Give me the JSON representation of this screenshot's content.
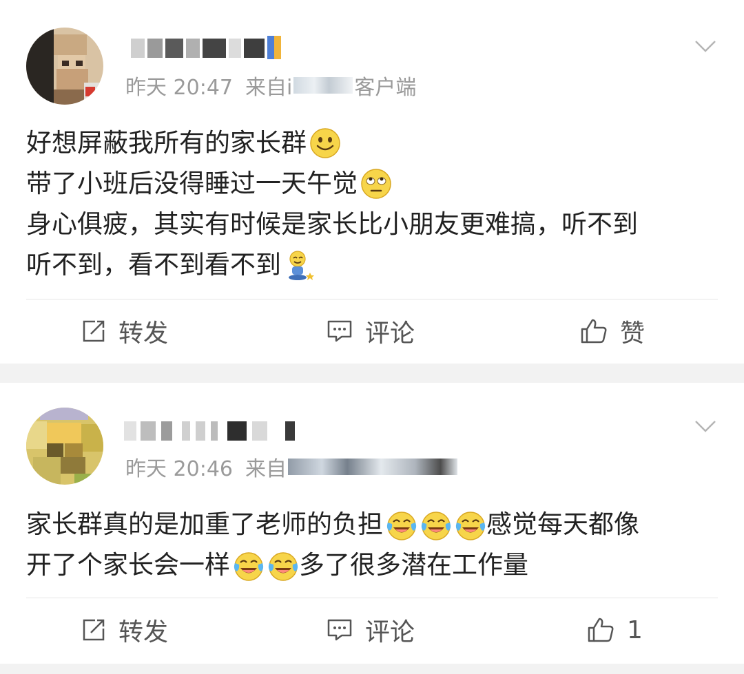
{
  "posts": [
    {
      "time_label": "昨天 20:47",
      "source_prefix": "来自i",
      "source_suffix": "客户端",
      "content_lines": [
        "好想屏蔽我所有的家长群",
        "带了小班后没得睡过一天午觉",
        "身心俱疲，其实有时候是家长比小朋友更难搞，听不到",
        "听不到，看不到看不到"
      ],
      "emojis": [
        "smile-emoji",
        "rolling-eyes-emoji",
        "sitting-child-emoji"
      ],
      "actions": {
        "repost": "转发",
        "comment": "评论",
        "like": "赞"
      }
    },
    {
      "time_label": "昨天 20:46",
      "source_prefix": "来自",
      "source_suffix": "",
      "content_lines": [
        "家长群真的是加重了老师的负担",
        "感觉每天都像",
        "开了个家长会一样",
        "多了很多潜在工作量"
      ],
      "emojis": [
        "laugh-cry-emoji"
      ],
      "actions": {
        "repost": "转发",
        "comment": "评论",
        "like": "1"
      }
    }
  ],
  "colors": {
    "background": "#f2f2f2",
    "card": "#ffffff",
    "meta_text": "#9a9a9a",
    "body_text": "#222222",
    "action_text": "#555555"
  }
}
